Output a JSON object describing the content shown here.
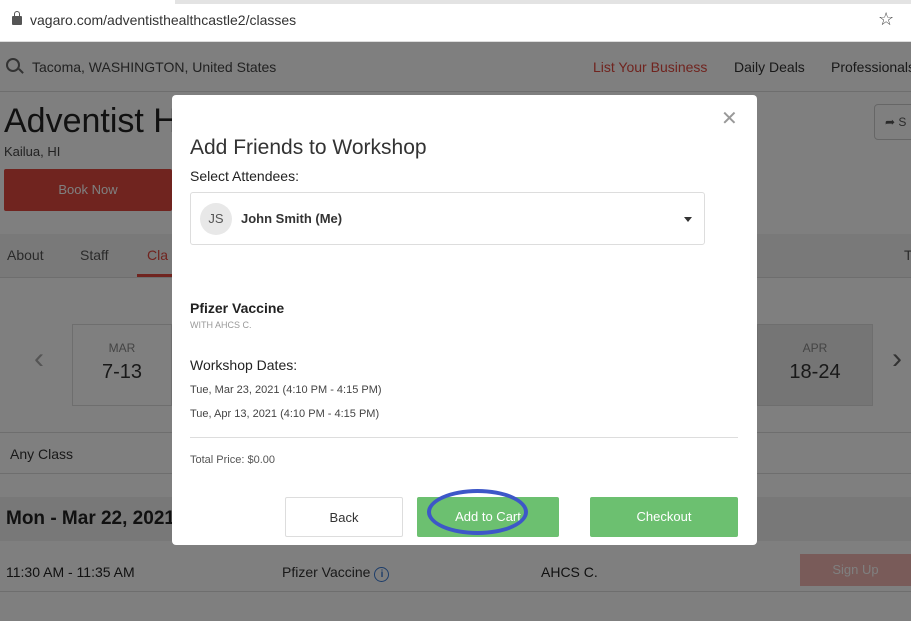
{
  "browser": {
    "url": "vagaro.com/adventisthealthcastle2/classes"
  },
  "nav": {
    "location": "Tacoma, WASHINGTON, United States",
    "list_business": "List Your Business",
    "daily_deals": "Daily Deals",
    "professionals": "Professionals"
  },
  "business": {
    "name": "Adventist He",
    "location": "Kailua, HI",
    "share_label": "S",
    "book_now": "Book Now"
  },
  "tabs": {
    "about": "About",
    "staff": "Staff",
    "classes": "Cla",
    "right": "T"
  },
  "weeks": {
    "left": {
      "month": "MAR",
      "range": "7-13"
    },
    "right": {
      "month": "APR",
      "range": "18-24"
    }
  },
  "filter": {
    "any_class": "Any Class"
  },
  "schedule": {
    "day": "Mon - Mar 22, 2021",
    "row": {
      "time": "11:30 AM - 11:35 AM",
      "class": "Pfizer Vaccine",
      "staff": "AHCS C.",
      "signup": "Sign Up"
    }
  },
  "modal": {
    "title": "Add Friends to Workshop",
    "select_label": "Select Attendees:",
    "attendee": {
      "initials": "JS",
      "name": "John Smith (Me)"
    },
    "class_name": "Pfizer Vaccine",
    "with": "WITH AHCS C.",
    "dates_label": "Workshop Dates:",
    "dates": [
      "Tue, Mar 23, 2021 (4:10 PM - 4:15 PM)",
      "Tue, Apr 13, 2021 (4:10 PM - 4:15 PM)"
    ],
    "total": "Total Price: $0.00",
    "buttons": {
      "back": "Back",
      "add_to_cart": "Add to Cart",
      "checkout": "Checkout"
    }
  },
  "colors": {
    "brand_red": "#e0483e",
    "green": "#6cc070",
    "highlight": "#3d57c8"
  }
}
